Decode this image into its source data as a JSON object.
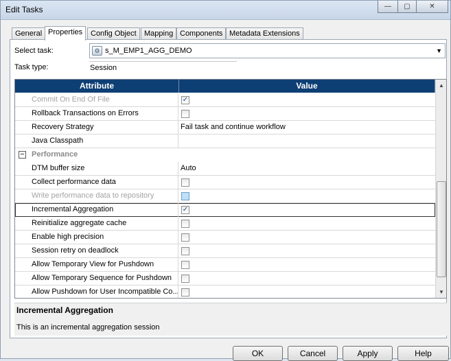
{
  "window": {
    "title": "Edit Tasks"
  },
  "tabs": [
    {
      "label": "General"
    },
    {
      "label": "Properties"
    },
    {
      "label": "Config Object"
    },
    {
      "label": "Mapping"
    },
    {
      "label": "Components"
    },
    {
      "label": "Metadata Extensions"
    }
  ],
  "active_tab": "Properties",
  "form": {
    "select_task_label": "Select task:",
    "select_task_value": "s_M_EMP1_AGG_DEMO",
    "task_type_label": "Task type:",
    "task_type_value": "Session"
  },
  "grid": {
    "headers": {
      "attribute": "Attribute",
      "value": "Value"
    },
    "rows": [
      {
        "attribute": "Commit On End Of File",
        "type": "checkbox",
        "checked": true,
        "disabled": true
      },
      {
        "attribute": "Rollback Transactions on Errors",
        "type": "checkbox",
        "checked": false,
        "disabled": false
      },
      {
        "attribute": "Recovery Strategy",
        "type": "text",
        "value": "Fail task and continue workflow",
        "disabled": false
      },
      {
        "attribute": "Java Classpath",
        "type": "text",
        "value": "",
        "disabled": false
      },
      {
        "section": "Performance",
        "expand_symbol": "−"
      },
      {
        "attribute": "DTM buffer size",
        "type": "text",
        "value": "Auto",
        "disabled": false
      },
      {
        "attribute": "Collect performance data",
        "type": "checkbox",
        "checked": false,
        "disabled": false
      },
      {
        "attribute": "Write performance data to repository",
        "type": "checkbox",
        "checked": false,
        "disabled": true
      },
      {
        "attribute": "Incremental Aggregation",
        "type": "checkbox",
        "checked": true,
        "disabled": false,
        "selected": true
      },
      {
        "attribute": "Reinitialize aggregate cache",
        "type": "checkbox",
        "checked": false,
        "disabled": false
      },
      {
        "attribute": "Enable high precision",
        "type": "checkbox",
        "checked": false,
        "disabled": false
      },
      {
        "attribute": "Session retry on deadlock",
        "type": "checkbox",
        "checked": false,
        "disabled": false
      },
      {
        "attribute": "Allow Temporary View for Pushdown",
        "type": "checkbox",
        "checked": false,
        "disabled": false
      },
      {
        "attribute": "Allow Temporary Sequence for Pushdown",
        "type": "checkbox",
        "checked": false,
        "disabled": false
      },
      {
        "attribute": "Allow Pushdown for User Incompatible Co...",
        "type": "checkbox",
        "checked": false,
        "disabled": false
      }
    ]
  },
  "description": {
    "title": "Incremental Aggregation",
    "text": "This is an incremental aggregation session"
  },
  "buttons": {
    "ok": "OK",
    "cancel": "Cancel",
    "apply": "Apply",
    "help": "Help"
  },
  "glyphs": {
    "check": "✓",
    "scroll_up": "▲",
    "scroll_down": "▼",
    "combo_arrow": "▼",
    "minimize": "—",
    "maximize": "▢",
    "close": "✕"
  },
  "colors": {
    "header_bg": "#0e3f74",
    "disabled_text": "#a3a3a3"
  }
}
